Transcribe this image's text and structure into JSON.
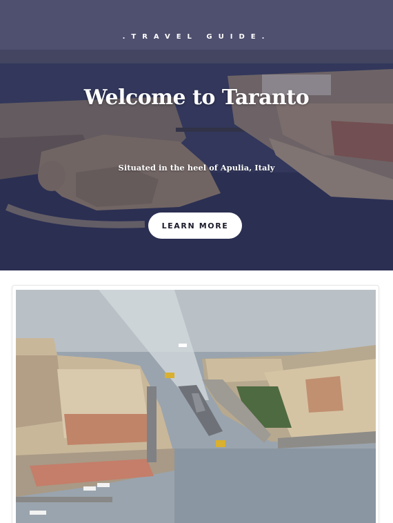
{
  "hero": {
    "kicker": ".TRAVEL GUIDE.",
    "title": "Welcome to Taranto",
    "subtitle": "Situated in the heel of Apulia, Italy",
    "cta_label": "LEARN MORE",
    "image_icon": "aerial-city-photo",
    "overlay_color": "#26244a"
  },
  "feature_card": {
    "image_icon": "aerial-harbor-photo"
  }
}
